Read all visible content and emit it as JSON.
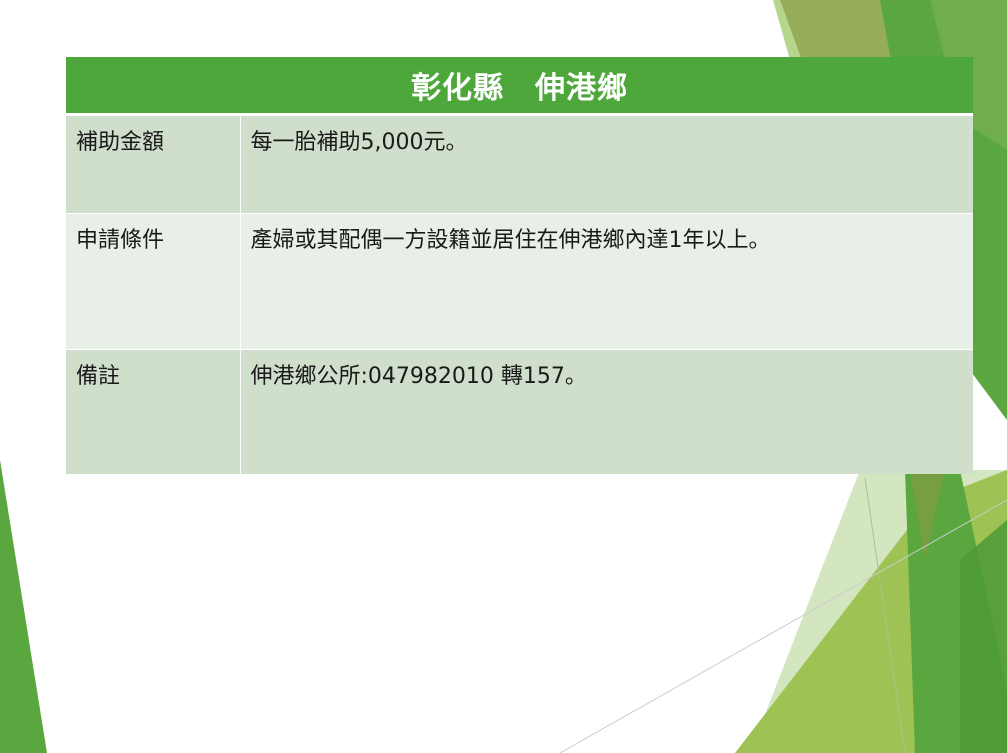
{
  "table": {
    "title": "彰化縣　伸港鄉",
    "rows": [
      {
        "label": "補助金額",
        "value": "每一胎補助5,000元。"
      },
      {
        "label": "申請條件",
        "value": "產婦或其配偶一方設籍並居住在伸港鄉內達1年以上。"
      },
      {
        "label": "備註",
        "value": "伸港鄉公所:047982010 轉157。"
      }
    ]
  },
  "colors": {
    "header_green": "#4ea73a",
    "row_dark": "#d0dfcb",
    "row_light": "#e8efe6",
    "accent_green": "#5aa63f",
    "light_green": "#9ec254"
  }
}
